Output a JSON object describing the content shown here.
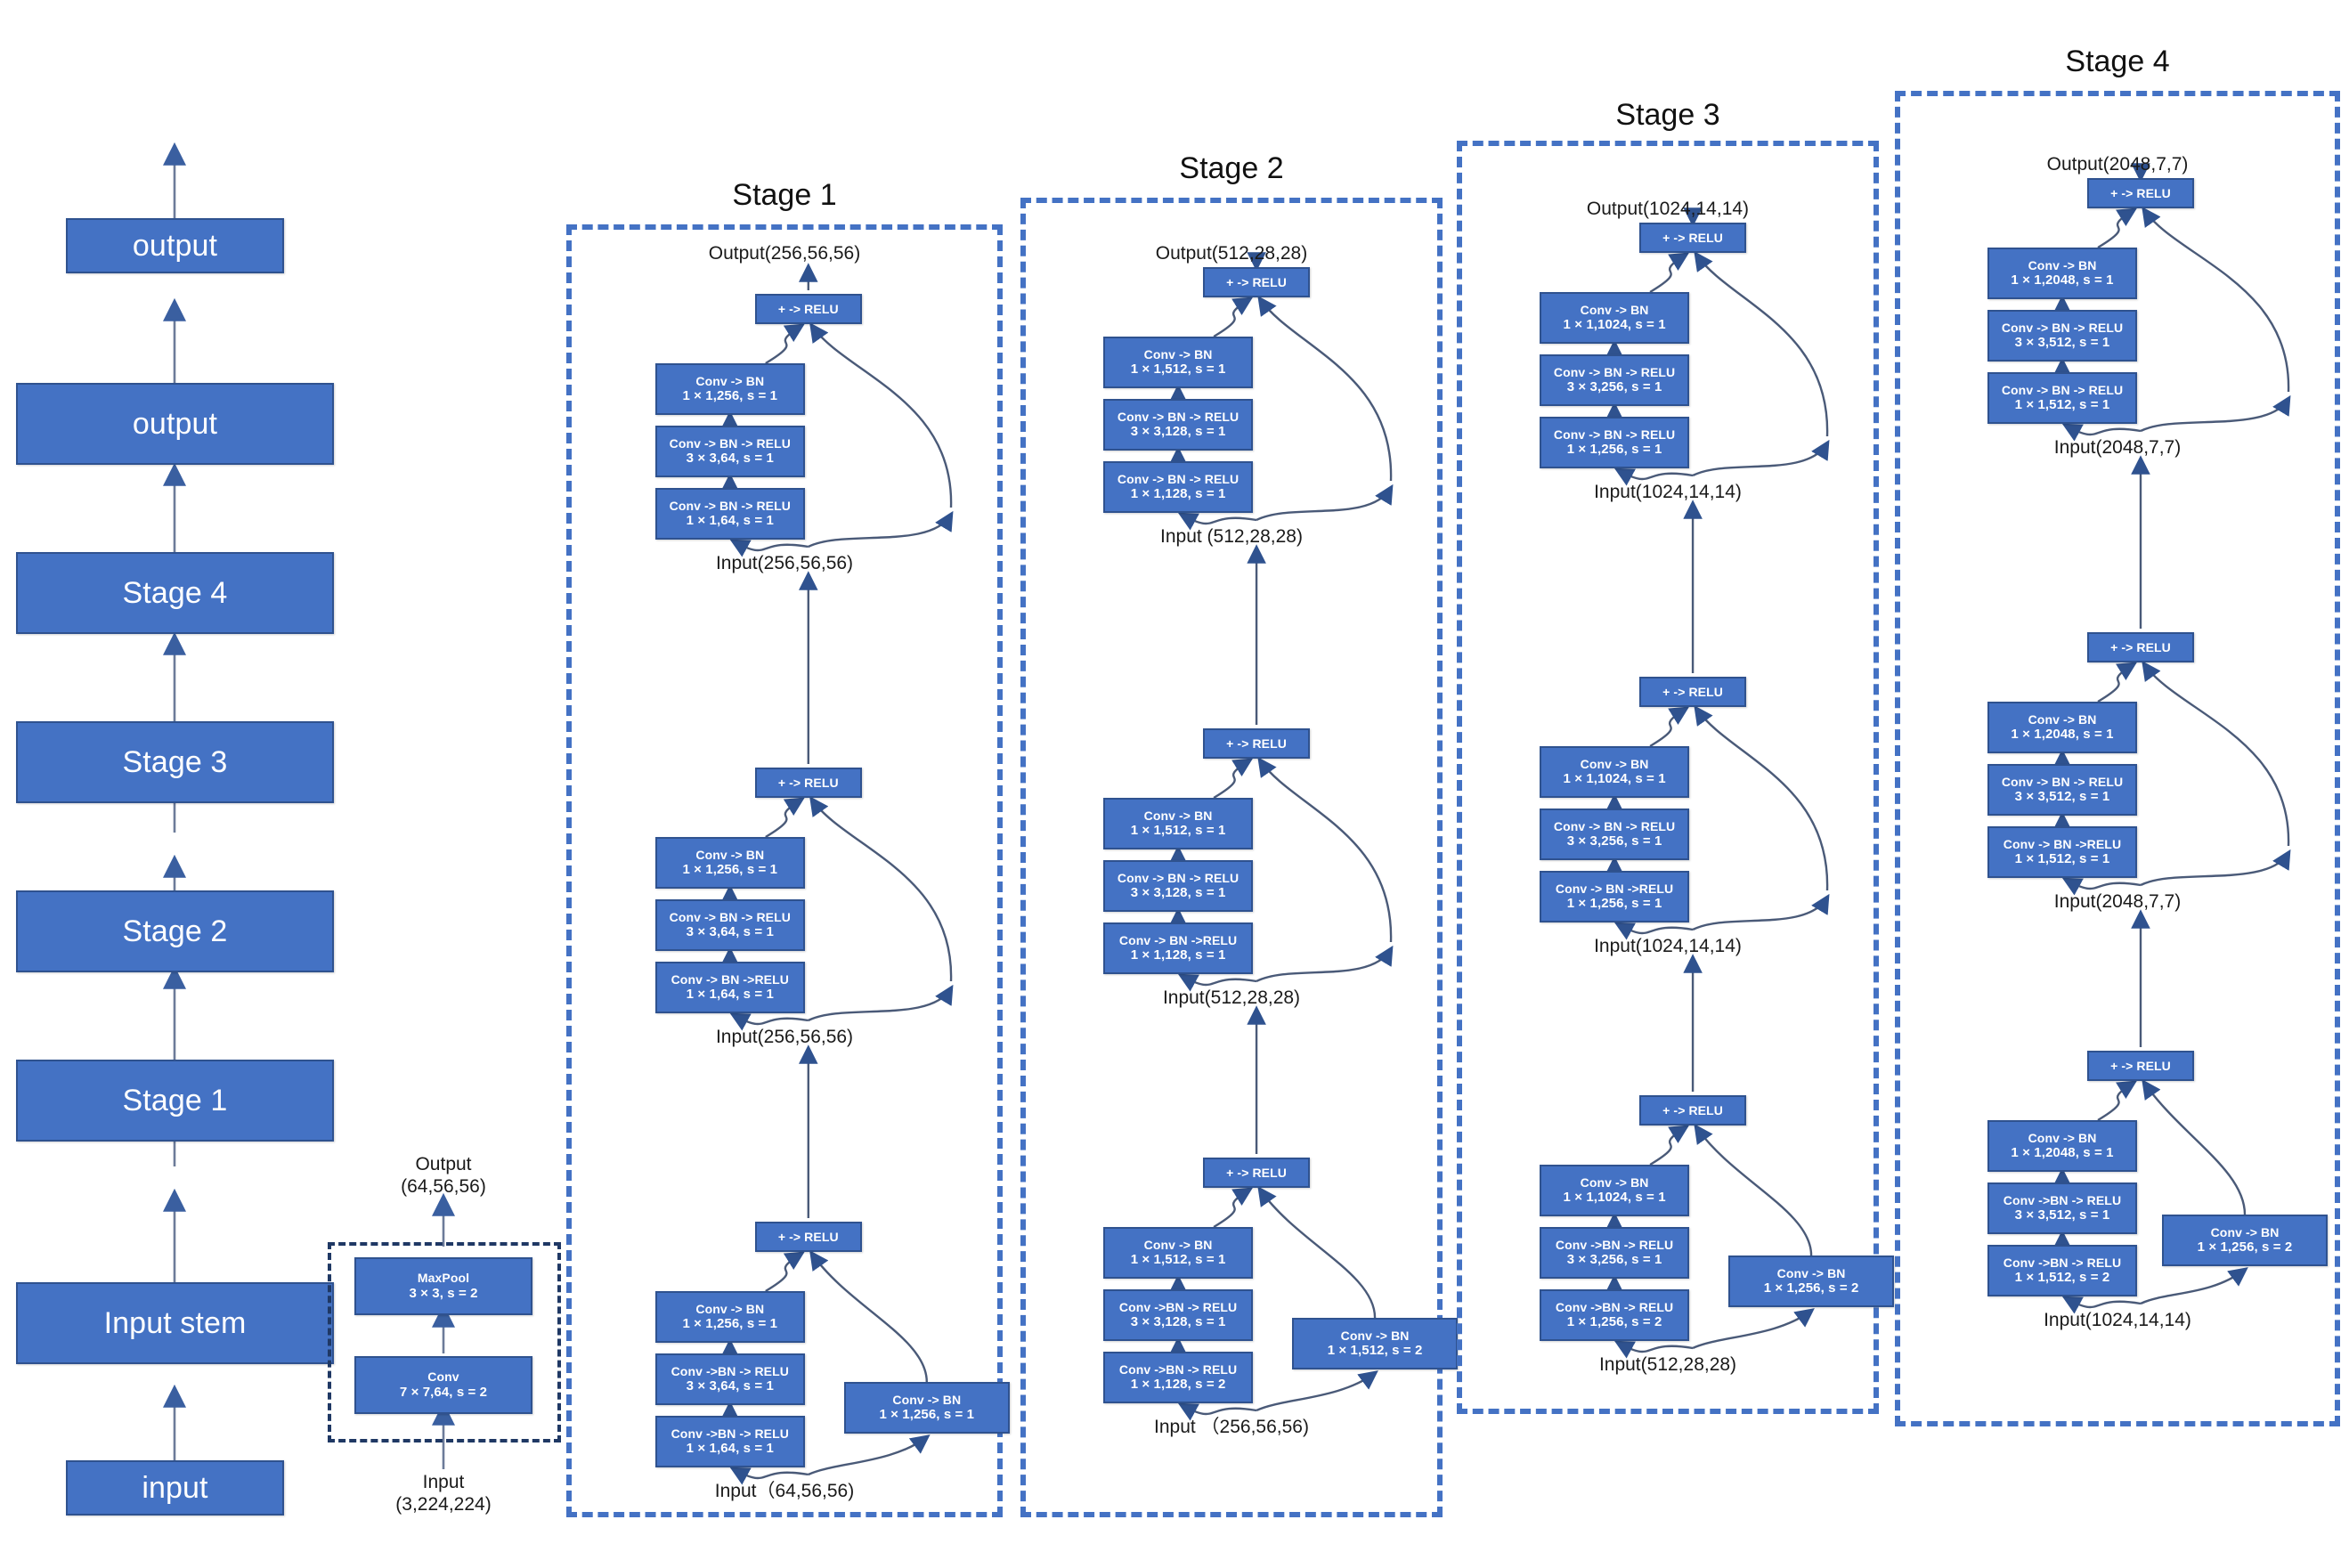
{
  "meta": {
    "title": "ResNet-50 architecture diagram",
    "colors": {
      "box_fill": "#4472C4",
      "box_stroke": "#2F528F",
      "frame_blue": "#4472C4",
      "frame_dark": "#1F3864",
      "text": "#111111"
    }
  },
  "overview": {
    "boxes": [
      {
        "label": "output"
      },
      {
        "label": "output"
      },
      {
        "label": "Stage 4"
      },
      {
        "label": "Stage 3"
      },
      {
        "label": "Stage 2"
      },
      {
        "label": "Stage 1"
      },
      {
        "label": "Input stem"
      },
      {
        "label": "input"
      }
    ]
  },
  "input_stem": {
    "output_note_line1": "Output",
    "output_note_line2": "(64,56,56)",
    "input_note_line1": "Input",
    "input_note_line2": "(3,224,224)",
    "maxpool": {
      "l1": "MaxPool",
      "l2": "3 × 3, s = 2"
    },
    "conv": {
      "l1": "Conv",
      "l2": "7 × 7,64, s = 2"
    }
  },
  "stages": [
    {
      "title": "Stage 1",
      "top_output": "Output(256,56,56)",
      "blocks": [
        {
          "name": "stage1-block3",
          "add": "+ -> RELU",
          "conv3": {
            "l1": "Conv -> BN",
            "l2": "1 × 1,256, s = 1"
          },
          "conv2": {
            "l1": "Conv -> BN -> RELU",
            "l2": "3 × 3,64, s = 1"
          },
          "conv1": {
            "l1": "Conv -> BN -> RELU",
            "l2": "1 × 1,64, s = 1"
          },
          "input_note": "Input(256,56,56)",
          "shortcut": null
        },
        {
          "name": "stage1-block2",
          "add": "+ -> RELU",
          "conv3": {
            "l1": "Conv -> BN",
            "l2": "1 × 1,256, s = 1"
          },
          "conv2": {
            "l1": "Conv -> BN -> RELU",
            "l2": "3 × 3,64, s = 1"
          },
          "conv1": {
            "l1": "Conv -> BN ->RELU",
            "l2": "1 × 1,64, s = 1"
          },
          "input_note": "Input(256,56,56)",
          "shortcut": null
        },
        {
          "name": "stage1-block1",
          "add": "+ -> RELU",
          "conv3": {
            "l1": "Conv -> BN",
            "l2": "1 × 1,256, s = 1"
          },
          "conv2": {
            "l1": "Conv ->BN -> RELU",
            "l2": "3 × 3,64, s = 1"
          },
          "conv1": {
            "l1": "Conv ->BN -> RELU",
            "l2": "1 × 1,64, s = 1"
          },
          "input_note": "Input（64,56,56)",
          "shortcut": {
            "l1": "Conv -> BN",
            "l2": "1 × 1,256, s = 1"
          }
        }
      ]
    },
    {
      "title": "Stage 2",
      "top_output": "Output(512,28,28)",
      "blocks": [
        {
          "name": "stage2-block4",
          "add": "+ -> RELU",
          "conv3": {
            "l1": "Conv -> BN",
            "l2": "1 × 1,512, s = 1"
          },
          "conv2": {
            "l1": "Conv -> BN -> RELU",
            "l2": "3 × 3,128, s = 1"
          },
          "conv1": {
            "l1": "Conv -> BN -> RELU",
            "l2": "1 × 1,128, s = 1"
          },
          "input_note": "Input (512,28,28)",
          "shortcut": null
        },
        {
          "name": "stage2-block3",
          "add": "+ -> RELU",
          "conv3": {
            "l1": "Conv -> BN",
            "l2": "1 × 1,512, s = 1"
          },
          "conv2": {
            "l1": "Conv -> BN -> RELU",
            "l2": "3 × 3,128, s = 1"
          },
          "conv1": {
            "l1": "Conv -> BN ->RELU",
            "l2": "1 × 1,128, s = 1"
          },
          "input_note": "Input(512,28,28)",
          "shortcut": null
        },
        {
          "name": "stage2-block2",
          "add": "+ -> RELU",
          "conv3": {
            "l1": "Conv -> BN",
            "l2": "1 × 1,512, s = 1"
          },
          "conv2": {
            "l1": "Conv ->BN -> RELU",
            "l2": "3 × 3,128, s = 1"
          },
          "conv1": {
            "l1": "Conv ->BN -> RELU",
            "l2": "1 × 1,128, s = 2"
          },
          "input_note": "Input （256,56,56)",
          "shortcut": {
            "l1": "Conv -> BN",
            "l2": "1 × 1,512, s = 2"
          }
        }
      ]
    },
    {
      "title": "Stage 3",
      "top_output": "Output(1024,14,14)",
      "blocks": [
        {
          "name": "stage3-block6",
          "add": "+ -> RELU",
          "conv3": {
            "l1": "Conv -> BN",
            "l2": "1 × 1,1024, s = 1"
          },
          "conv2": {
            "l1": "Conv -> BN -> RELU",
            "l2": "3 × 3,256, s = 1"
          },
          "conv1": {
            "l1": "Conv -> BN -> RELU",
            "l2": "1 × 1,256, s = 1"
          },
          "input_note": "Input(1024,14,14)",
          "shortcut": null
        },
        {
          "name": "stage3-block5",
          "add": "+ -> RELU",
          "conv3": {
            "l1": "Conv -> BN",
            "l2": "1 × 1,1024, s = 1"
          },
          "conv2": {
            "l1": "Conv -> BN -> RELU",
            "l2": "3 × 3,256, s = 1"
          },
          "conv1": {
            "l1": "Conv -> BN ->RELU",
            "l2": "1 × 1,256, s = 1"
          },
          "input_note": "Input(1024,14,14)",
          "shortcut": null
        },
        {
          "name": "stage3-block4",
          "add": "+ -> RELU",
          "conv3": {
            "l1": "Conv -> BN",
            "l2": "1 × 1,1024, s = 1"
          },
          "conv2": {
            "l1": "Conv ->BN -> RELU",
            "l2": "3 × 3,256, s = 1"
          },
          "conv1": {
            "l1": "Conv ->BN -> RELU",
            "l2": "1 × 1,256, s = 2"
          },
          "input_note": "Input(512,28,28)",
          "shortcut": {
            "l1": "Conv -> BN",
            "l2": "1 × 1,256, s = 2"
          }
        }
      ]
    },
    {
      "title": "Stage 4",
      "top_output": "Output(2048,7,7)",
      "blocks": [
        {
          "name": "stage4-block3",
          "add": "+ -> RELU",
          "conv3": {
            "l1": "Conv -> BN",
            "l2": "1 × 1,2048, s = 1"
          },
          "conv2": {
            "l1": "Conv -> BN -> RELU",
            "l2": "3 × 3,512, s = 1"
          },
          "conv1": {
            "l1": "Conv -> BN -> RELU",
            "l2": "1 × 1,512, s = 1"
          },
          "input_note": "Input(2048,7,7)",
          "shortcut": null
        },
        {
          "name": "stage4-block2",
          "add": "+ -> RELU",
          "conv3": {
            "l1": "Conv -> BN",
            "l2": "1 × 1,2048, s = 1"
          },
          "conv2": {
            "l1": "Conv -> BN -> RELU",
            "l2": "3 × 3,512, s = 1"
          },
          "conv1": {
            "l1": "Conv -> BN ->RELU",
            "l2": "1 × 1,512, s = 1"
          },
          "input_note": "Input(2048,7,7)",
          "shortcut": null
        },
        {
          "name": "stage4-block1",
          "add": "+ -> RELU",
          "conv3": {
            "l1": "Conv -> BN",
            "l2": "1 × 1,2048, s = 1"
          },
          "conv2": {
            "l1": "Conv ->BN -> RELU",
            "l2": "3 × 3,512, s = 1"
          },
          "conv1": {
            "l1": "Conv ->BN -> RELU",
            "l2": "1 × 1,512, s = 2"
          },
          "input_note": "Input(1024,14,14)",
          "shortcut": {
            "l1": "Conv -> BN",
            "l2": "1 × 1,256, s = 2"
          }
        }
      ]
    }
  ]
}
